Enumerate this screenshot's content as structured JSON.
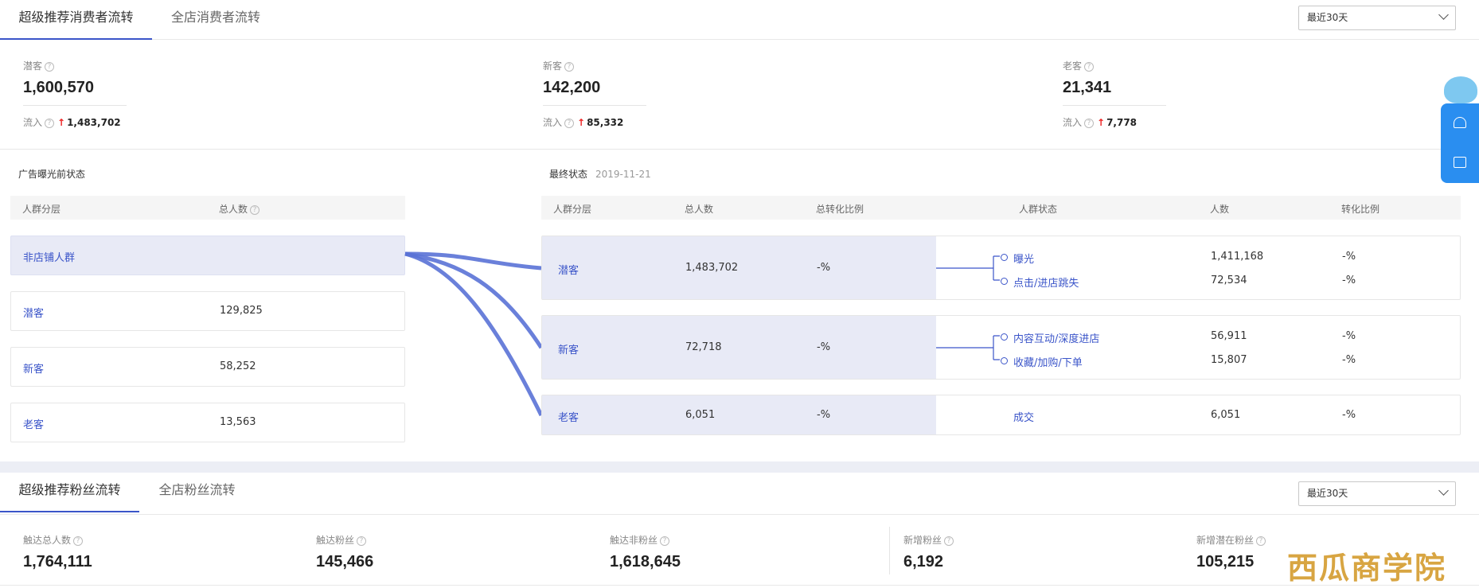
{
  "top_tabs": {
    "active": "超级推荐消费者流转",
    "inactive": "全店消费者流转",
    "range": "最近30天"
  },
  "metrics": [
    {
      "label": "潜客",
      "value": "1,600,570",
      "flow_label": "流入",
      "flow_value": "1,483,702"
    },
    {
      "label": "新客",
      "value": "142,200",
      "flow_label": "流入",
      "flow_value": "85,332"
    },
    {
      "label": "老客",
      "value": "21,341",
      "flow_label": "流入",
      "flow_value": "7,778"
    }
  ],
  "before": {
    "title": "广告曝光前状态",
    "headers": {
      "segment": "人群分层",
      "total": "总人数"
    },
    "rows": [
      {
        "name": "非店铺人群",
        "count": ""
      },
      {
        "name": "潜客",
        "count": "129,825"
      },
      {
        "name": "新客",
        "count": "58,252"
      },
      {
        "name": "老客",
        "count": "13,563"
      }
    ]
  },
  "final": {
    "title": "最终状态",
    "date": "2019-11-21",
    "headers": {
      "segment": "人群分层",
      "total": "总人数",
      "total_rate": "总转化比例",
      "state": "人群状态",
      "people": "人数",
      "rate": "转化比例"
    },
    "rows": [
      {
        "name": "潜客",
        "total": "1,483,702",
        "rate": "-%",
        "states": [
          {
            "label": "曝光",
            "count": "1,411,168",
            "rate": "-%"
          },
          {
            "label": "点击/进店跳失",
            "count": "72,534",
            "rate": "-%"
          }
        ]
      },
      {
        "name": "新客",
        "total": "72,718",
        "rate": "-%",
        "states": [
          {
            "label": "内容互动/深度进店",
            "count": "56,911",
            "rate": "-%"
          },
          {
            "label": "收藏/加购/下单",
            "count": "15,807",
            "rate": "-%"
          }
        ]
      },
      {
        "name": "老客",
        "total": "6,051",
        "rate": "-%",
        "states": [
          {
            "label": "成交",
            "count": "6,051",
            "rate": "-%"
          }
        ]
      }
    ]
  },
  "bottom_tabs": {
    "active": "超级推荐粉丝流转",
    "inactive": "全店粉丝流转",
    "range": "最近30天"
  },
  "fan_metrics": [
    {
      "label": "触达总人数",
      "value": "1,764,111"
    },
    {
      "label": "触达粉丝",
      "value": "145,466"
    },
    {
      "label": "触达非粉丝",
      "value": "1,618,645"
    },
    {
      "label": "新增粉丝",
      "value": "6,192"
    },
    {
      "label": "新增潜在粉丝",
      "value": "105,215"
    }
  ],
  "watermark": "西瓜商学院",
  "icons": {
    "help": "question-circle-icon",
    "up": "arrow-up-icon",
    "chevron": "chevron-down-icon",
    "bell": "bell-icon",
    "message": "message-icon"
  },
  "colors": {
    "accent": "#3b55c9",
    "up_arrow": "#e22222",
    "highlight": "#e8eaf6",
    "widget": "#2a8ef0"
  }
}
